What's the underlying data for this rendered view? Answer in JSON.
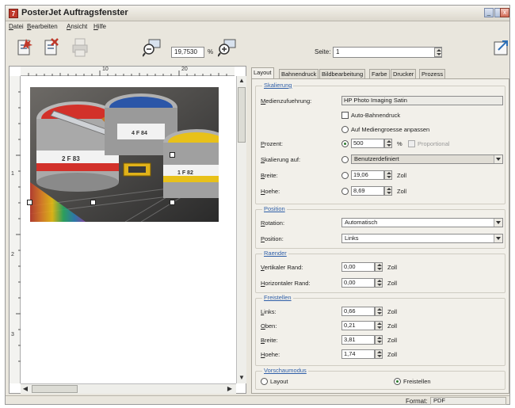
{
  "window": {
    "title": "PosterJet Auftragsfenster",
    "app_icon": "7"
  },
  "menu": [
    "Datei",
    "Bearbeiten",
    "Ansicht",
    "Hilfe"
  ],
  "toolbar": {
    "icons": [
      "new-job-icon",
      "delete-job-icon",
      "print-icon",
      "zoom-out-icon",
      "zoom-in-icon",
      "export-icon"
    ],
    "zoom_value": "19,7530",
    "zoom_unit": "%",
    "page_label": "Seite:",
    "page_value": "1"
  },
  "preview": {
    "ruler_h": [
      "10",
      "20"
    ],
    "ruler_v": [
      "1",
      "2",
      "3"
    ]
  },
  "tabs": [
    "Layout",
    "Bahnendruck",
    "Bildbearbeitung",
    "Farbe",
    "Drucker",
    "Prozess"
  ],
  "active_tab": "Layout",
  "skalierung": {
    "title": "Skalierung",
    "medium_label": "Medienzufuehrung:",
    "medium_value": "HP Photo Imaging Satin",
    "auto_bahnendruck": "Auto-Bahnendruck",
    "auf_mediengroesse": "Auf Mediengroesse anpassen",
    "prozent_label": "Prozent:",
    "prozent_value": "500",
    "prozent_unit": "%",
    "proportional": "Proportional",
    "skalierung_auf_label": "Skalierung auf:",
    "skalierung_auf_value": "Benutzerdefiniert",
    "breite_label": "Breite:",
    "breite_value": "19,06",
    "breite_unit": "Zoll",
    "hoehe_label": "Hoehe:",
    "hoehe_value": "8,69",
    "hoehe_unit": "Zoll"
  },
  "position": {
    "title": "Position",
    "rotation_label": "Rotation:",
    "rotation_value": "Automatisch",
    "position_label": "Position:",
    "position_value": "Links"
  },
  "raender": {
    "title": "Raender",
    "vertikal_label": "Vertikaler Rand:",
    "vertikal_value": "0,00",
    "horizontal_label": "Horizontaler Rand:",
    "horizontal_value": "0,00",
    "unit": "Zoll"
  },
  "freistellen": {
    "title": "Freistellen",
    "links_label": "Links:",
    "links_value": "0,66",
    "oben_label": "Oben:",
    "oben_value": "0,21",
    "breite_label": "Breite:",
    "breite_value": "3,81",
    "hoehe_label": "Hoehe:",
    "hoehe_value": "1,74",
    "unit": "Zoll"
  },
  "vorschaumodus": {
    "title": "Vorschaumodus",
    "layout_label": "Layout",
    "freistellen_label": "Freistellen",
    "selected": "Freistellen"
  },
  "status": {
    "format_label": "Format:",
    "format_value": "PDF"
  },
  "colors": {
    "window_bg": "#e9e6dd",
    "panel_bg": "#f2f0ea",
    "group_title": "#2f5fa8"
  }
}
